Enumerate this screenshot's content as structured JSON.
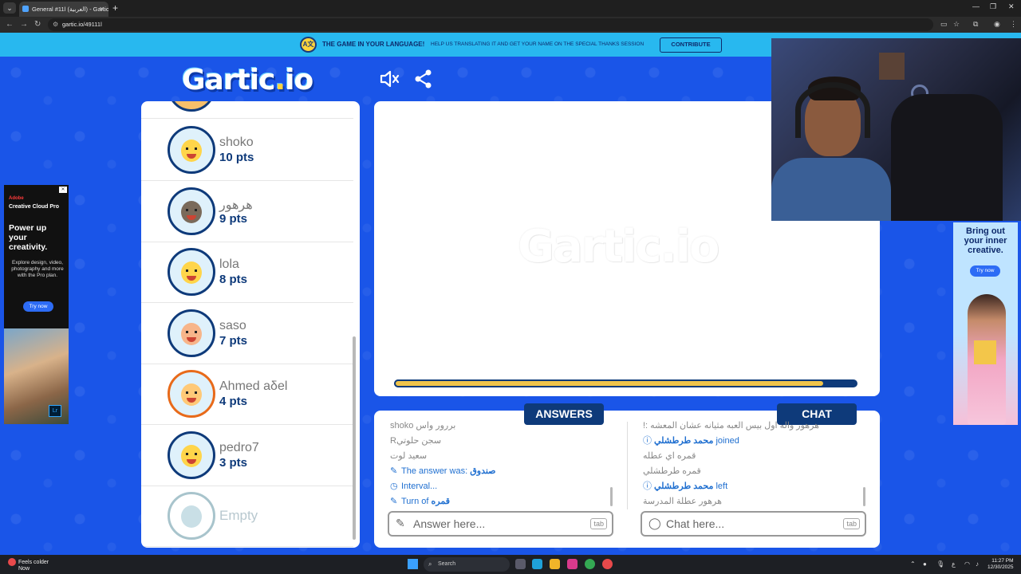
{
  "browser": {
    "tab_title": "General #11l (العربية) - Gartic.io",
    "url": "gartic.io/49111l"
  },
  "banner": {
    "bold_text": "THE GAME IN YOUR LANGUAGE!",
    "sub_text": "HELP US TRANSLATING IT AND GET YOUR NAME ON THE SPECIAL THANKS SESSION",
    "contribute_label": "CONTRIBUTE"
  },
  "logo": {
    "pre": "Gartic",
    "dot": ".",
    "post": "io"
  },
  "players": [
    {
      "name": "shoko",
      "points": "10 pts",
      "face_color": "#ffd54a",
      "ring": "#0e3a7a"
    },
    {
      "name": "هرهور",
      "points": "9 pts",
      "face_color": "#7a6a5a",
      "ring": "#0e3a7a"
    },
    {
      "name": "lola",
      "points": "8 pts",
      "face_color": "#ffd54a",
      "ring": "#0e3a7a"
    },
    {
      "name": "saso",
      "points": "7 pts",
      "face_color": "#f7b58a",
      "ring": "#0e3a7a"
    },
    {
      "name": "Ahmed aδel",
      "points": "4 pts",
      "face_color": "#ffc978",
      "ring": "#e86a1a"
    },
    {
      "name": "pedro7",
      "points": "3 pts",
      "face_color": "#ffd54a",
      "ring": "#0e3a7a"
    },
    {
      "name": "Empty",
      "points": "",
      "face_color": "#c9dfe6",
      "ring": "#a8c4cc"
    }
  ],
  "board": {
    "watermark": "Gartic.io",
    "timer_fraction": 0.93
  },
  "answers": {
    "label": "ANSWERS",
    "lines": [
      {
        "type": "usr",
        "text": "shoko بررور واس"
      },
      {
        "type": "usr",
        "text": "Rسجن حلوتي"
      },
      {
        "type": "usr",
        "text": "سعيد لوت"
      },
      {
        "type": "sys",
        "icon": "pencil",
        "text": "The answer was:",
        "bold": "صندوق"
      },
      {
        "type": "sys",
        "icon": "clock",
        "text": "Interval...",
        "bold": ""
      },
      {
        "type": "sys",
        "icon": "pencil",
        "text": "Turn of",
        "bold": "قمره"
      }
    ],
    "placeholder": "Answer here...",
    "tab_hint": "tab"
  },
  "chat": {
    "label": "CHAT",
    "lines": [
      {
        "type": "usr",
        "text": "!: هرهور واله اول بيس العبه مثيانه عشان المعشه"
      },
      {
        "type": "sys",
        "icon": "info",
        "bold": "محمد طرطشلي",
        "text": "joined"
      },
      {
        "type": "usr",
        "text": "قمره اي عطله"
      },
      {
        "type": "usr",
        "text": "قمره طرطشلي"
      },
      {
        "type": "sys",
        "icon": "info",
        "bold": "محمد طرطشلي",
        "text": "left"
      },
      {
        "type": "usr",
        "text": "هرهور عطلة المدرسة"
      }
    ],
    "placeholder": "Chat here...",
    "tab_hint": "tab"
  },
  "ads": {
    "left": {
      "brand": "Adobe",
      "product": "Creative Cloud Pro",
      "headline": "Power up your creativity.",
      "body": "Explore design, video, photography and more with the Pro plan.",
      "cta": "Try now",
      "app_badge": "Lr"
    },
    "right": {
      "headline": "Bring out your inner creative.",
      "cta": "Try now"
    }
  },
  "taskbar": {
    "weather": "Feels colder",
    "weather_sub": "Now",
    "search": "Search",
    "time": "11:27 PM",
    "date": "12/30/2025"
  },
  "colors": {
    "field": "#1a55e8",
    "navy": "#0e3a7a",
    "timer": "#f0c44a",
    "banner": "#28b8ef"
  }
}
